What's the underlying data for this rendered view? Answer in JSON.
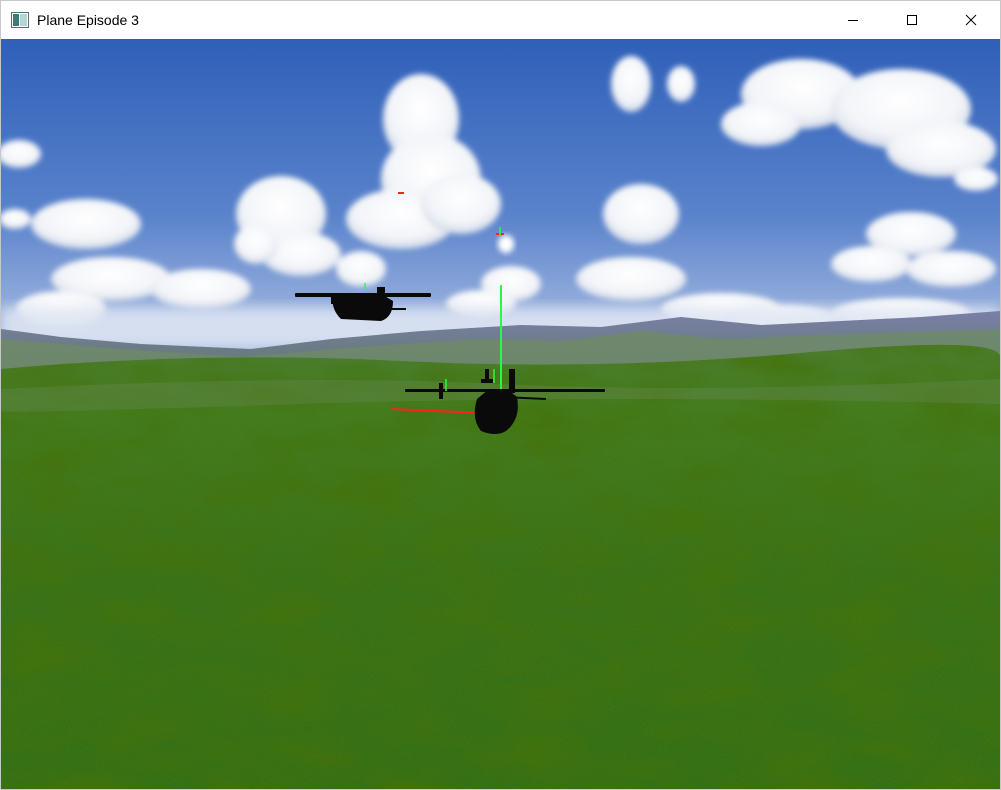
{
  "window": {
    "title": "Plane Episode 3"
  },
  "caption_buttons": {
    "minimize_icon": "minimize-icon",
    "maximize_icon": "maximize-icon",
    "close_icon": "close-icon"
  },
  "scene": {
    "sky_top_color": "#2f5fb8",
    "sky_horizon_color": "#9db3da",
    "grass_color": "#2f6a12",
    "aircraft": [
      {
        "role": "lead-aircraft"
      },
      {
        "role": "wingman-aircraft"
      }
    ],
    "markers": {
      "axis_x_color": "#ff2020",
      "axis_y_color": "#20ff40"
    }
  }
}
